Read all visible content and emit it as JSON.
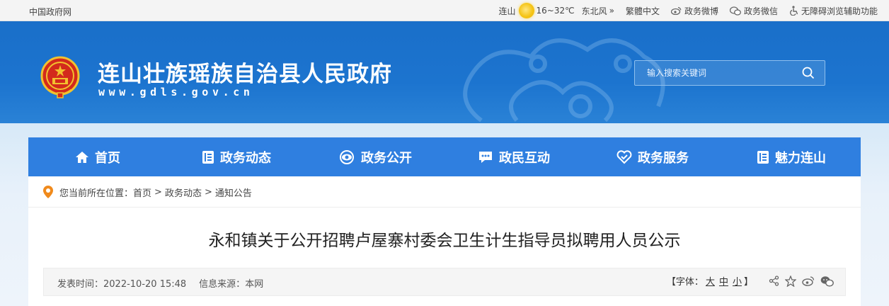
{
  "topbar": {
    "site_link": "中国政府网",
    "weather": {
      "city": "连山",
      "temp": "16~32℃",
      "wind": "东北风",
      "wind_arrow": "»"
    },
    "links": [
      {
        "label": "繁體中文",
        "icon": "none"
      },
      {
        "label": "政务微博",
        "icon": "weibo-icon"
      },
      {
        "label": "政务微信",
        "icon": "wechat-icon"
      },
      {
        "label": "无障碍浏览辅助功能",
        "icon": "accessibility-icon"
      }
    ]
  },
  "header": {
    "title": "连山壮族瑶族自治县人民政府",
    "url": "www.gdls.gov.cn",
    "search_placeholder": "输入搜索关键词",
    "emblem_icon": "national-emblem-icon"
  },
  "nav": {
    "items": [
      {
        "label": "首页",
        "icon": "home-icon"
      },
      {
        "label": "政务动态",
        "icon": "document-icon"
      },
      {
        "label": "政务公开",
        "icon": "eye-icon"
      },
      {
        "label": "政民互动",
        "icon": "chat-icon"
      },
      {
        "label": "政务服务",
        "icon": "heart-icon"
      },
      {
        "label": "魅力连山",
        "icon": "document-icon"
      }
    ]
  },
  "breadcrumb": {
    "prefix": "您当前所在位置：",
    "items": [
      "首页",
      "政务动态",
      "通知公告"
    ],
    "separator": ">"
  },
  "article": {
    "title": "永和镇关于公开招聘卢屋寨村委会卫生计生指导员拟聘用人员公示",
    "publish_label": "发表时间：",
    "publish_time": "2022-10-20 15:48",
    "source_label": "信息来源：",
    "source": "本网",
    "font_label_open": "【字体：",
    "font_sizes": [
      "大",
      "中",
      "小"
    ],
    "font_label_close": "】",
    "share_icons": [
      "share-icon",
      "star-icon",
      "weibo-icon",
      "wechat-icon"
    ]
  },
  "colors": {
    "banner": "#1c74cf",
    "nav": "#2f7fe0",
    "accent_orange": "#f08a1c"
  }
}
